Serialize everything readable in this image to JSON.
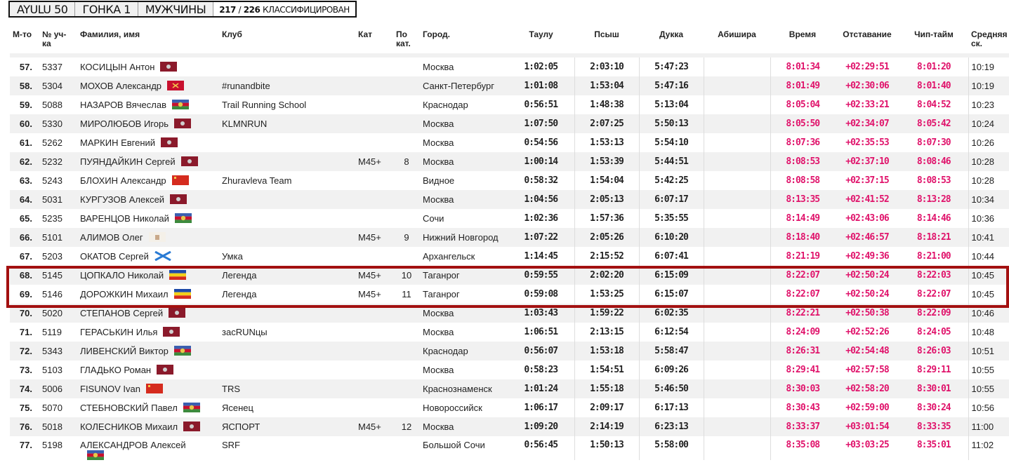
{
  "breadcrumb": {
    "event": "AYULU 50",
    "race": "ГОНКА 1",
    "group": "МУЖЧИНЫ",
    "classified": "217",
    "separator": "/",
    "total": "226",
    "status": "КЛАССИФИЦИРОВАН"
  },
  "columns": {
    "rank": "М-то",
    "number": "№ уч-ка",
    "name": "Фамилия, имя",
    "club": "Клуб",
    "category": "Кат",
    "cat_place": "По кат.",
    "city": "Город.",
    "cp1": "Таулу",
    "cp2": "Псыш",
    "cp3": "Дукка",
    "cp4": "Абишира",
    "time": "Время",
    "gap": "Отставание",
    "chip": "Чип-тайм",
    "speed": "Средняя ск."
  },
  "flag_colors": {
    "moscow": "#8b1a2b",
    "krasnodar": "#3a5fb0",
    "spb": "#c8102e",
    "russia_red": "#d52b1e",
    "rostov_blue": "#1f4aa8",
    "rostov_yellow": "#f3d01a",
    "rostov_red": "#d52b1e",
    "st_andrew": "#2a7bd4",
    "nn": "#f4f0e8"
  },
  "rows": [
    {
      "rank": "57.",
      "number": "5337",
      "name": "КОСИЦЫН Антон",
      "flag": "moscow",
      "club": "",
      "category": "",
      "cat_place": "",
      "city": "Москва",
      "cp1": "1:02:05",
      "cp2": "2:03:10",
      "cp3": "5:47:23",
      "cp4": "",
      "time": "8:01:34",
      "gap": "+02:29:51",
      "chip": "8:01:20",
      "speed": "10:19"
    },
    {
      "rank": "58.",
      "number": "5304",
      "name": "МОХОВ Александр",
      "flag": "spb",
      "club": "#runandbite",
      "category": "",
      "cat_place": "",
      "city": "Санкт-Петербург",
      "cp1": "1:01:08",
      "cp2": "1:53:04",
      "cp3": "5:47:16",
      "cp4": "",
      "time": "8:01:49",
      "gap": "+02:30:06",
      "chip": "8:01:40",
      "speed": "10:19"
    },
    {
      "rank": "59.",
      "number": "5088",
      "name": "НАЗАРОВ Вячеслав",
      "flag": "krasnodar",
      "club": "Trail Running School",
      "category": "",
      "cat_place": "",
      "city": "Краснодар",
      "cp1": "0:56:51",
      "cp2": "1:48:38",
      "cp3": "5:13:04",
      "cp4": "",
      "time": "8:05:04",
      "gap": "+02:33:21",
      "chip": "8:04:52",
      "speed": "10:23"
    },
    {
      "rank": "60.",
      "number": "5330",
      "name": "МИРОЛЮБОВ Игорь",
      "flag": "moscow",
      "club": "KLMNRUN",
      "category": "",
      "cat_place": "",
      "city": "Москва",
      "cp1": "1:07:50",
      "cp2": "2:07:25",
      "cp3": "5:50:13",
      "cp4": "",
      "time": "8:05:50",
      "gap": "+02:34:07",
      "chip": "8:05:42",
      "speed": "10:24"
    },
    {
      "rank": "61.",
      "number": "5262",
      "name": "МАРКИН Евгений",
      "flag": "moscow",
      "club": "",
      "category": "",
      "cat_place": "",
      "city": "Москва",
      "cp1": "0:54:56",
      "cp2": "1:53:13",
      "cp3": "5:54:10",
      "cp4": "",
      "time": "8:07:36",
      "gap": "+02:35:53",
      "chip": "8:07:30",
      "speed": "10:26"
    },
    {
      "rank": "62.",
      "number": "5232",
      "name": "ПУЯНДАЙКИН Сергей",
      "flag": "moscow",
      "club": "",
      "category": "M45+",
      "cat_place": "8",
      "city": "Москва",
      "cp1": "1:00:14",
      "cp2": "1:53:39",
      "cp3": "5:44:51",
      "cp4": "",
      "time": "8:08:53",
      "gap": "+02:37:10",
      "chip": "8:08:46",
      "speed": "10:28"
    },
    {
      "rank": "63.",
      "number": "5243",
      "name": "БЛОХИН Александр",
      "flag": "russia_red",
      "club": "Zhuravleva Team",
      "category": "",
      "cat_place": "",
      "city": "Видное",
      "cp1": "0:58:32",
      "cp2": "1:54:04",
      "cp3": "5:42:25",
      "cp4": "",
      "time": "8:08:58",
      "gap": "+02:37:15",
      "chip": "8:08:53",
      "speed": "10:28"
    },
    {
      "rank": "64.",
      "number": "5031",
      "name": "КУРГУЗОВ Алексей",
      "flag": "moscow",
      "club": "",
      "category": "",
      "cat_place": "",
      "city": "Москва",
      "cp1": "1:04:56",
      "cp2": "2:05:13",
      "cp3": "6:07:17",
      "cp4": "",
      "time": "8:13:35",
      "gap": "+02:41:52",
      "chip": "8:13:28",
      "speed": "10:34"
    },
    {
      "rank": "65.",
      "number": "5235",
      "name": "ВАРЕНЦОВ Николай",
      "flag": "krasnodar",
      "club": "",
      "category": "",
      "cat_place": "",
      "city": "Сочи",
      "cp1": "1:02:36",
      "cp2": "1:57:36",
      "cp3": "5:35:55",
      "cp4": "",
      "time": "8:14:49",
      "gap": "+02:43:06",
      "chip": "8:14:46",
      "speed": "10:36"
    },
    {
      "rank": "66.",
      "number": "5101",
      "name": "АЛИМОВ Олег",
      "flag": "nn",
      "club": "",
      "category": "M45+",
      "cat_place": "9",
      "city": "Нижний Новгород",
      "cp1": "1:07:22",
      "cp2": "2:05:26",
      "cp3": "6:10:20",
      "cp4": "",
      "time": "8:18:40",
      "gap": "+02:46:57",
      "chip": "8:18:21",
      "speed": "10:41"
    },
    {
      "rank": "67.",
      "number": "5203",
      "name": "ОКАТОВ Сергей",
      "flag": "st_andrew",
      "club": "Умка",
      "category": "",
      "cat_place": "",
      "city": "Архангельск",
      "cp1": "1:14:45",
      "cp2": "2:15:52",
      "cp3": "6:07:41",
      "cp4": "",
      "time": "8:21:19",
      "gap": "+02:49:36",
      "chip": "8:21:00",
      "speed": "10:44"
    },
    {
      "rank": "68.",
      "number": "5145",
      "name": "ЦОПКАЛО Николай",
      "flag": "rostov",
      "club": "Легенда",
      "category": "M45+",
      "cat_place": "10",
      "city": "Таганрог",
      "cp1": "0:59:55",
      "cp2": "2:02:20",
      "cp3": "6:15:09",
      "cp4": "",
      "time": "8:22:07",
      "gap": "+02:50:24",
      "chip": "8:22:03",
      "speed": "10:45"
    },
    {
      "rank": "69.",
      "number": "5146",
      "name": "ДОРОЖКИН Михаил",
      "flag": "rostov",
      "club": "Легенда",
      "category": "M45+",
      "cat_place": "11",
      "city": "Таганрог",
      "cp1": "0:59:08",
      "cp2": "1:53:25",
      "cp3": "6:15:07",
      "cp4": "",
      "time": "8:22:07",
      "gap": "+02:50:24",
      "chip": "8:22:07",
      "speed": "10:45"
    },
    {
      "rank": "70.",
      "number": "5020",
      "name": "СТЕПАНОВ Сергей",
      "flag": "moscow",
      "club": "",
      "category": "",
      "cat_place": "",
      "city": "Москва",
      "cp1": "1:03:43",
      "cp2": "1:59:22",
      "cp3": "6:02:35",
      "cp4": "",
      "time": "8:22:21",
      "gap": "+02:50:38",
      "chip": "8:22:09",
      "speed": "10:46"
    },
    {
      "rank": "71.",
      "number": "5119",
      "name": "ГЕРАСЬКИН Илья",
      "flag": "moscow",
      "club": "засRUNцы",
      "category": "",
      "cat_place": "",
      "city": "Москва",
      "cp1": "1:06:51",
      "cp2": "2:13:15",
      "cp3": "6:12:54",
      "cp4": "",
      "time": "8:24:09",
      "gap": "+02:52:26",
      "chip": "8:24:05",
      "speed": "10:48"
    },
    {
      "rank": "72.",
      "number": "5343",
      "name": "ЛИВЕНСКИЙ Виктор",
      "flag": "krasnodar",
      "club": "",
      "category": "",
      "cat_place": "",
      "city": "Краснодар",
      "cp1": "0:56:07",
      "cp2": "1:53:18",
      "cp3": "5:58:47",
      "cp4": "",
      "time": "8:26:31",
      "gap": "+02:54:48",
      "chip": "8:26:03",
      "speed": "10:51"
    },
    {
      "rank": "73.",
      "number": "5103",
      "name": "ГЛАДЬКО Роман",
      "flag": "moscow",
      "club": "",
      "category": "",
      "cat_place": "",
      "city": "Москва",
      "cp1": "0:58:23",
      "cp2": "1:54:51",
      "cp3": "6:09:26",
      "cp4": "",
      "time": "8:29:41",
      "gap": "+02:57:58",
      "chip": "8:29:11",
      "speed": "10:55"
    },
    {
      "rank": "74.",
      "number": "5006",
      "name": "FISUNOV Ivan",
      "flag": "russia_red",
      "club": "TRS",
      "category": "",
      "cat_place": "",
      "city": "Краснознаменск",
      "cp1": "1:01:24",
      "cp2": "1:55:18",
      "cp3": "5:46:50",
      "cp4": "",
      "time": "8:30:03",
      "gap": "+02:58:20",
      "chip": "8:30:01",
      "speed": "10:55"
    },
    {
      "rank": "75.",
      "number": "5070",
      "name": "СТЕБНОВСКИЙ Павел",
      "flag": "krasnodar",
      "club": "Ясенец",
      "category": "",
      "cat_place": "",
      "city": "Новороссийск",
      "cp1": "1:06:17",
      "cp2": "2:09:17",
      "cp3": "6:17:13",
      "cp4": "",
      "time": "8:30:43",
      "gap": "+02:59:00",
      "chip": "8:30:24",
      "speed": "10:56"
    },
    {
      "rank": "76.",
      "number": "5018",
      "name": "КОЛЕСНИКОВ Михаил",
      "flag": "moscow",
      "club": "ЯСПОРТ",
      "category": "M45+",
      "cat_place": "12",
      "city": "Москва",
      "cp1": "1:09:20",
      "cp2": "2:14:19",
      "cp3": "6:23:13",
      "cp4": "",
      "time": "8:33:37",
      "gap": "+03:01:54",
      "chip": "8:33:35",
      "speed": "11:00"
    },
    {
      "rank": "77.",
      "number": "5198",
      "name": "АЛЕКСАНДРОВ Алексей",
      "flag": "krasnodar_block",
      "club": "SRF",
      "category": "",
      "cat_place": "",
      "city": "Большой Сочи",
      "cp1": "0:56:45",
      "cp2": "1:50:13",
      "cp3": "5:58:00",
      "cp4": "",
      "time": "8:35:08",
      "gap": "+03:03:25",
      "chip": "8:35:01",
      "speed": "11:02"
    }
  ]
}
